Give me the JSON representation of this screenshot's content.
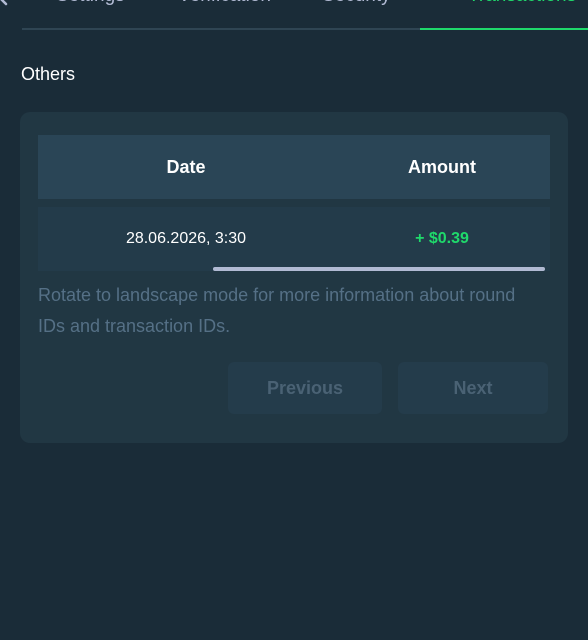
{
  "tabs": [
    {
      "label": "Settings",
      "active": false
    },
    {
      "label": "Verification",
      "active": false
    },
    {
      "label": "Security",
      "active": false
    },
    {
      "label": "Transactions",
      "active": true
    }
  ],
  "section_title": "Others",
  "table": {
    "headers": {
      "date": "Date",
      "amount": "Amount"
    },
    "rows": [
      {
        "date": "28.06.2026, 3:30",
        "amount": "+ $0.39"
      }
    ]
  },
  "hint": "Rotate to landscape mode for more information about round IDs and transaction IDs.",
  "pagination": {
    "previous_label": "Previous",
    "next_label": "Next"
  },
  "colors": {
    "background": "#1a2c38",
    "card": "#213743",
    "accent_green": "#1fd96b",
    "muted_text": "#557086"
  }
}
